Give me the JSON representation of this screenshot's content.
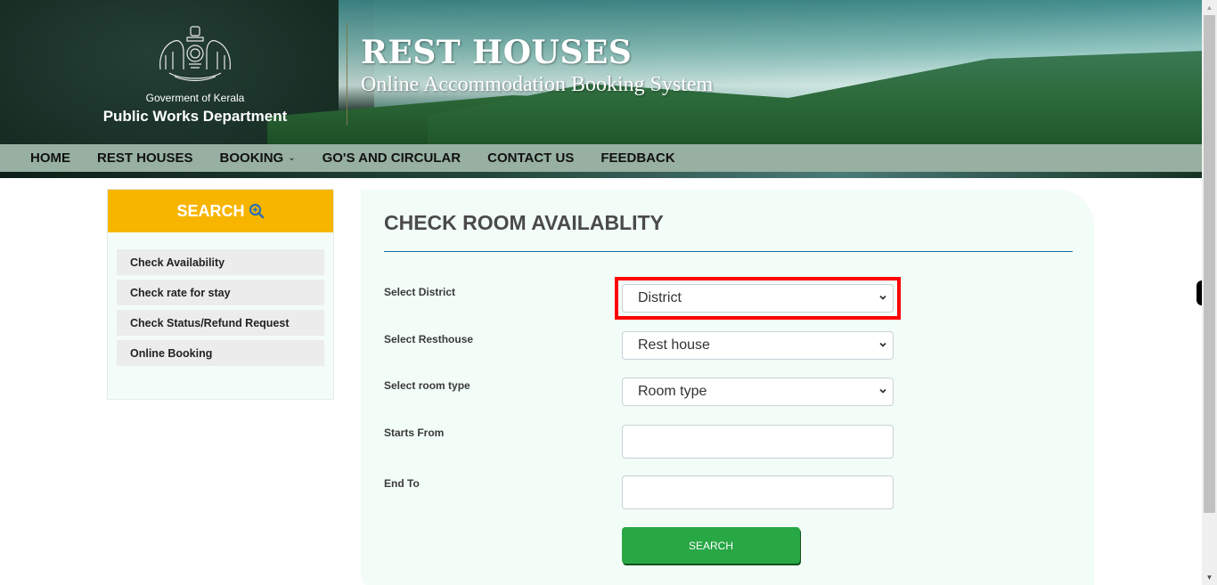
{
  "header": {
    "government": "Goverment of Kerala",
    "department": "Public Works Department",
    "title": "REST HOUSES",
    "subtitle": "Online Accommodation Booking System",
    "emblem_icon": "kerala-emblem-icon"
  },
  "nav": {
    "items": [
      {
        "label": "HOME",
        "has_dropdown": false
      },
      {
        "label": "REST HOUSES",
        "has_dropdown": false
      },
      {
        "label": "BOOKING",
        "has_dropdown": true
      },
      {
        "label": "GO'S AND CIRCULAR",
        "has_dropdown": false
      },
      {
        "label": "CONTACT US",
        "has_dropdown": false
      },
      {
        "label": "FEEDBACK",
        "has_dropdown": false
      }
    ],
    "dropdown_glyph": "⌄"
  },
  "sidebar": {
    "heading": "SEARCH",
    "heading_icon": "zoom-in-icon",
    "items": [
      {
        "label": "Check Availability"
      },
      {
        "label": "Check rate for stay"
      },
      {
        "label": "Check Status/Refund Request"
      },
      {
        "label": "Online Booking"
      }
    ]
  },
  "form": {
    "title": "CHECK ROOM AVAILABLITY",
    "fields": {
      "district": {
        "label": "Select District",
        "value": "District"
      },
      "resthouse": {
        "label": "Select Resthouse",
        "value": "Rest house"
      },
      "room_type": {
        "label": "Select room type",
        "value": "Room type"
      },
      "start": {
        "label": "Starts From",
        "value": ""
      },
      "end": {
        "label": "End To",
        "value": ""
      }
    },
    "submit_label": "SEARCH"
  },
  "colors": {
    "nav_bg": "#97b0a1",
    "sidebar_head": "#f7b500",
    "panel_bg": "#f2fdf7",
    "title_rule": "#1c6a9c",
    "search_button": "#28a745",
    "highlight": "#ff0000"
  }
}
